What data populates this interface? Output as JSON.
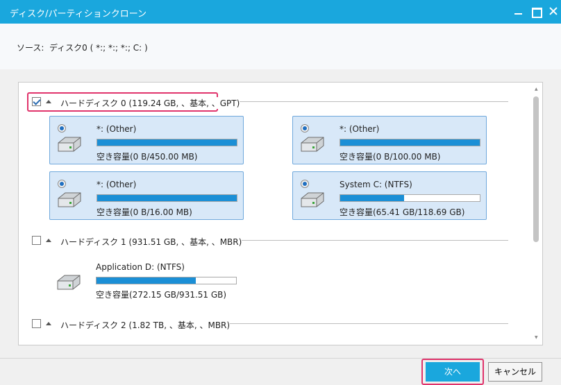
{
  "window": {
    "title": "ディスク/パーティションクローン",
    "controls": [
      "minimize",
      "maximize",
      "close"
    ]
  },
  "source": {
    "label": "ソース:",
    "value": "ディスク0 ( *:; *:; *:; C: )"
  },
  "disks": [
    {
      "label": "ハードディスク 0 (119.24 GB, 、基本, 、GPT)",
      "checked": true,
      "partitions": [
        {
          "name": "*: (Other)",
          "free": "空き容量(0 B/450.00 MB)",
          "used_fraction": 1.0
        },
        {
          "name": "*: (Other)",
          "free": "空き容量(0 B/100.00 MB)",
          "used_fraction": 1.0
        },
        {
          "name": "*: (Other)",
          "free": "空き容量(0 B/16.00 MB)",
          "used_fraction": 1.0
        },
        {
          "name": "System C: (NTFS)",
          "free": "空き容量(65.41 GB/118.69 GB)",
          "used_fraction": 0.45
        }
      ]
    },
    {
      "label": "ハードディスク 1 (931.51 GB, 、基本, 、MBR)",
      "checked": false,
      "partitions": [
        {
          "name": "Application D: (NTFS)",
          "free": "空き容量(272.15 GB/931.51 GB)",
          "used_fraction": 0.71
        }
      ]
    },
    {
      "label": "ハードディスク 2 (1.82 TB, 、基本, 、MBR)",
      "checked": false,
      "partitions": []
    }
  ],
  "buttons": {
    "next": "次へ",
    "cancel": "キャンセル"
  },
  "colors": {
    "accent": "#1aa7dd",
    "bar_fill": "#1b8fd6",
    "card_bg": "#d8e8f8",
    "highlight": "#e0336b"
  }
}
